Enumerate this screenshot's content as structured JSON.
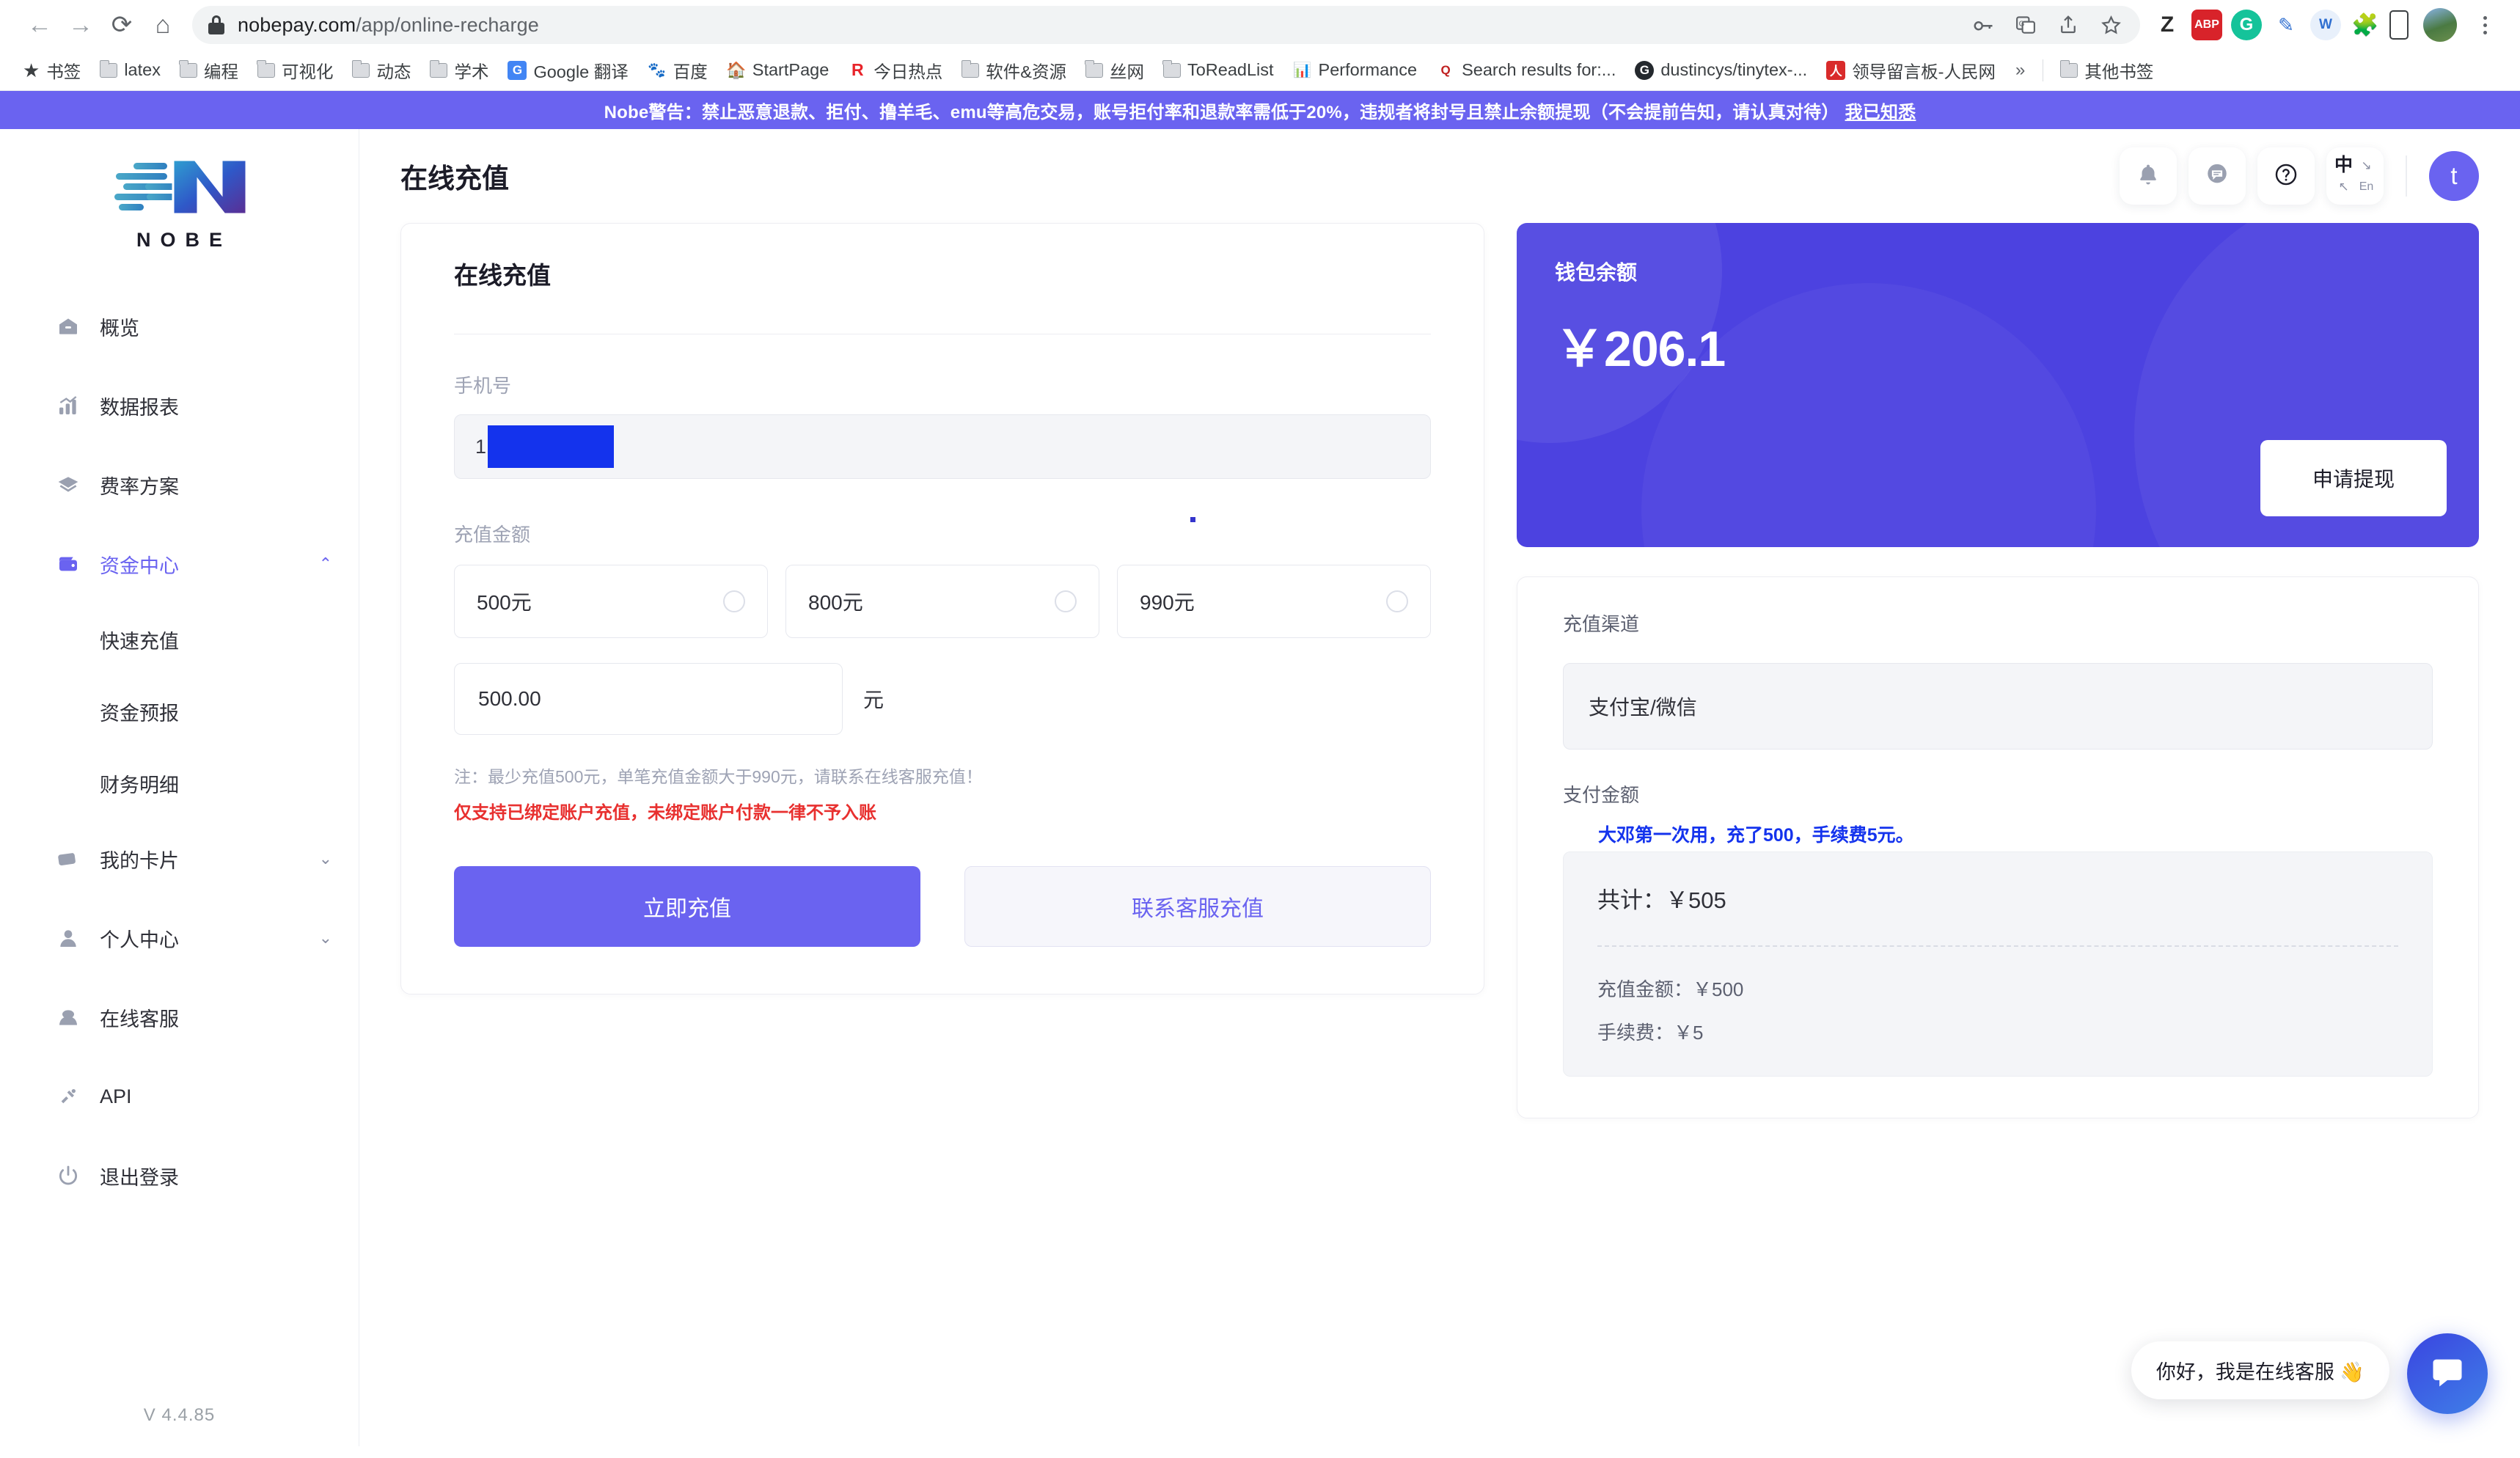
{
  "browser": {
    "url_domain": "nobepay.com",
    "url_path": "/app/online-recharge",
    "nav": {
      "back": "←",
      "forward": "→",
      "reload": "⟳",
      "home": "⌂"
    },
    "bookmarks": [
      {
        "label": "书签",
        "icon": "star-icon"
      },
      {
        "label": "latex",
        "icon": "folder-icon"
      },
      {
        "label": "编程",
        "icon": "folder-icon"
      },
      {
        "label": "可视化",
        "icon": "folder-icon"
      },
      {
        "label": "动态",
        "icon": "folder-icon"
      },
      {
        "label": "学术",
        "icon": "folder-icon"
      },
      {
        "label": "Google 翻译",
        "icon": "google-translate-icon"
      },
      {
        "label": "百度",
        "icon": "baidu-icon"
      },
      {
        "label": "StartPage",
        "icon": "startpage-icon"
      },
      {
        "label": "今日热点",
        "icon": "refind-icon"
      },
      {
        "label": "软件&资源",
        "icon": "folder-icon"
      },
      {
        "label": "丝网",
        "icon": "folder-icon"
      },
      {
        "label": "ToReadList",
        "icon": "folder-icon"
      },
      {
        "label": "Performance",
        "icon": "performance-icon"
      },
      {
        "label": "Search results for:...",
        "icon": "quantsy-icon"
      },
      {
        "label": "dustincys/tinytex-...",
        "icon": "github-icon"
      },
      {
        "label": "领导留言板-人民网",
        "icon": "people-icon"
      }
    ],
    "bookmarks_overflow": "»",
    "other_bookmarks": "其他书签",
    "extensions": [
      "zotero",
      "abp",
      "grammarly",
      "markdown",
      "weibo",
      "puzzle",
      "mobile"
    ]
  },
  "alert": {
    "text": "Nobe警告：禁止恶意退款、拒付、撸羊毛、emu等高危交易，账号拒付率和退款率需低于20%，违规者将封号且禁止余额提现（不会提前告知，请认真对待）",
    "ack_label": "我已知悉",
    "bg_color": "#6a63f0"
  },
  "sidebar": {
    "logo_word": "NOBE",
    "items": [
      {
        "label": "概览",
        "icon": "home-icon",
        "active": false,
        "caret": ""
      },
      {
        "label": "数据报表",
        "icon": "chart-bar-icon",
        "active": false,
        "caret": ""
      },
      {
        "label": "费率方案",
        "icon": "diamond-icon",
        "active": false,
        "caret": ""
      },
      {
        "label": "资金中心",
        "icon": "wallet-icon",
        "active": true,
        "caret": "⌃"
      }
    ],
    "sub_items": [
      {
        "label": "快速充值"
      },
      {
        "label": "资金预报"
      },
      {
        "label": "财务明细"
      }
    ],
    "items_after": [
      {
        "label": "我的卡片",
        "icon": "card-icon",
        "active": false,
        "caret": "⌄"
      },
      {
        "label": "个人中心",
        "icon": "user-icon",
        "active": false,
        "caret": "⌄"
      },
      {
        "label": "在线客服",
        "icon": "headset-icon",
        "active": false,
        "caret": ""
      },
      {
        "label": "API",
        "icon": "plug-icon",
        "active": false,
        "caret": ""
      },
      {
        "label": "退出登录",
        "icon": "power-icon",
        "active": false,
        "caret": ""
      }
    ],
    "version": "V 4.4.85"
  },
  "header": {
    "title": "在线充值",
    "icons": [
      {
        "name": "bell-icon"
      },
      {
        "name": "message-icon"
      },
      {
        "name": "help-icon"
      }
    ],
    "lang_cn": "中",
    "lang_en": "En",
    "avatar_initial": "t",
    "accent_color": "#6a63f0"
  },
  "form": {
    "title": "在线充值",
    "phone_label": "手机号",
    "phone_prefix": "1",
    "phone_redacted": true,
    "amount_label": "充值金额",
    "amount_options": [
      {
        "label": "500元",
        "value": 500,
        "selected": false
      },
      {
        "label": "800元",
        "value": 800,
        "selected": false
      },
      {
        "label": "990元",
        "value": 990,
        "selected": false
      }
    ],
    "custom_amount": "500.00",
    "custom_unit": "元",
    "note": "注：最少充值500元，单笔充值金额大于990元，请联系在线客服充值！",
    "note_warning": "仅支持已绑定账户充值，未绑定账户付款一律不予入账",
    "primary_button": "立即充值",
    "secondary_button": "联系客服充值"
  },
  "wallet": {
    "label": "钱包余额",
    "amount": "￥206.1",
    "withdraw_button": "申请提现",
    "bg_color": "#4c42e0"
  },
  "channel": {
    "label": "充值渠道",
    "selected": "支付宝/微信",
    "pay_label": "支付金额",
    "annotation": "大邓第一次用，充了500，手续费5元。",
    "total_line": "共计：￥505",
    "recharge_line": "充值金额：￥500",
    "fee_line": "手续费：￥5"
  },
  "chat": {
    "bubble_text": "你好，我是在线客服 👋",
    "fab_icon": "chat-icon"
  }
}
